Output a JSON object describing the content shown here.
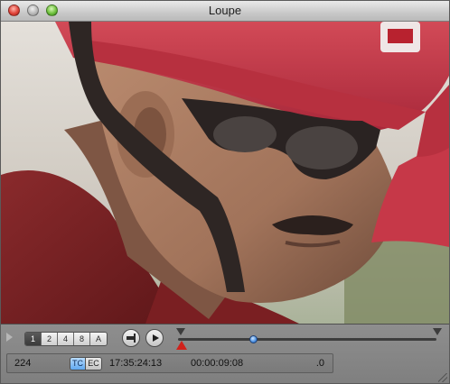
{
  "window": {
    "title": "Loupe"
  },
  "controls": {
    "zoom_buttons": [
      {
        "label": "1",
        "selected": true
      },
      {
        "label": "2",
        "selected": false
      },
      {
        "label": "4",
        "selected": false
      },
      {
        "label": "8",
        "selected": false
      },
      {
        "label": "A",
        "selected": false
      }
    ],
    "playback_position_fraction": 0.29
  },
  "info": {
    "frame_number": "224",
    "tc_option": "TC",
    "ec_option": "EC",
    "timecode": "17:35:24:13",
    "duration": "00:00:09:08",
    "speed": ".0"
  },
  "colors": {
    "playhead": "#d0211b",
    "scrubber": "#4a8fe0",
    "tc_active": "#5fa8ef"
  }
}
